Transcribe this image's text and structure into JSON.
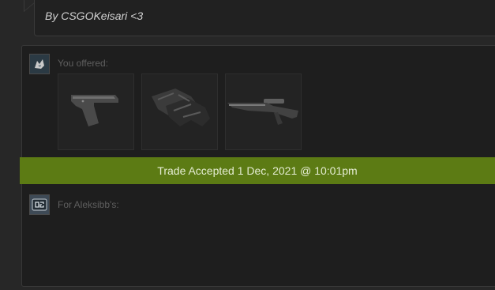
{
  "message": {
    "text": "By CSGOKeisari <3"
  },
  "offer_you": {
    "label": "You offered:",
    "items": [
      {
        "icon": "pistol-icon"
      },
      {
        "icon": "gloves-icon"
      },
      {
        "icon": "sniper-rifle-icon"
      }
    ]
  },
  "trade_status": {
    "text": "Trade Accepted 1 Dec, 2021 @ 10:01pm",
    "color": "#5c7b14"
  },
  "offer_them": {
    "label": "For Aleksibb's:"
  }
}
